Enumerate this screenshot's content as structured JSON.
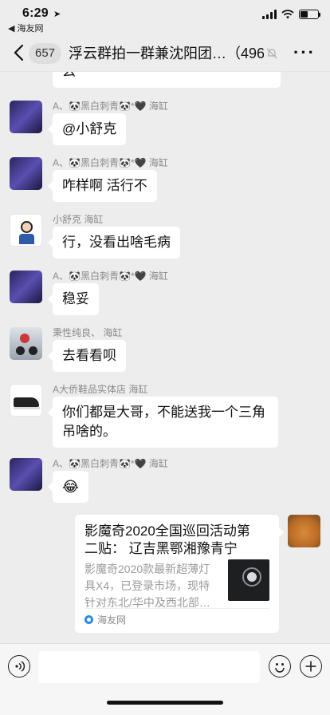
{
  "status": {
    "time": "6:29",
    "back_app": "◀ 海友网"
  },
  "nav": {
    "unread": "657",
    "title": "浮云群拍一群兼沈阳团…（496）"
  },
  "messages": [
    {
      "sender": "A、🐼黑白刺青🐼*🖤 海缸",
      "text": "@小舒克"
    },
    {
      "sender": "A、🐼黑白刺青🐼*🖤 海缸",
      "text": "咋样啊 活行不"
    },
    {
      "sender": "小舒克 海缸",
      "text": "行，没看出啥毛病"
    },
    {
      "sender": "A、🐼黑白刺青🐼*🖤 海缸",
      "text": "稳妥"
    },
    {
      "sender": "秉性纯良、 海缸",
      "text": "去看看呗"
    },
    {
      "sender": "A大侨鞋品实体店 海缸",
      "text_line1": "你们都是大哥，不能送我一个三角",
      "text_line2": "吊啥的。"
    },
    {
      "sender": "A、🐼黑白刺青🐼*🖤 海缸",
      "text": "😂"
    }
  ],
  "top_partial": "么",
  "link_card": {
    "title_line1": "影魔奇2020全国巡回活动第",
    "title_line2": "二贴： 辽吉黑鄂湘豫青宁",
    "desc_line1": "影魔奇2020款最新超薄灯",
    "desc_line2": "具X4，已登录市场，现特",
    "desc_line3": "针对东北/华中及西北部…",
    "source": "海友网"
  },
  "icons": [
    "back-chevron-icon",
    "mute-bell-icon",
    "more-icon",
    "voice-icon",
    "emoji-icon",
    "plus-icon"
  ],
  "colors": {
    "background": "#ededed",
    "bubble": "#ffffff",
    "meta": "#8a8a8a"
  }
}
